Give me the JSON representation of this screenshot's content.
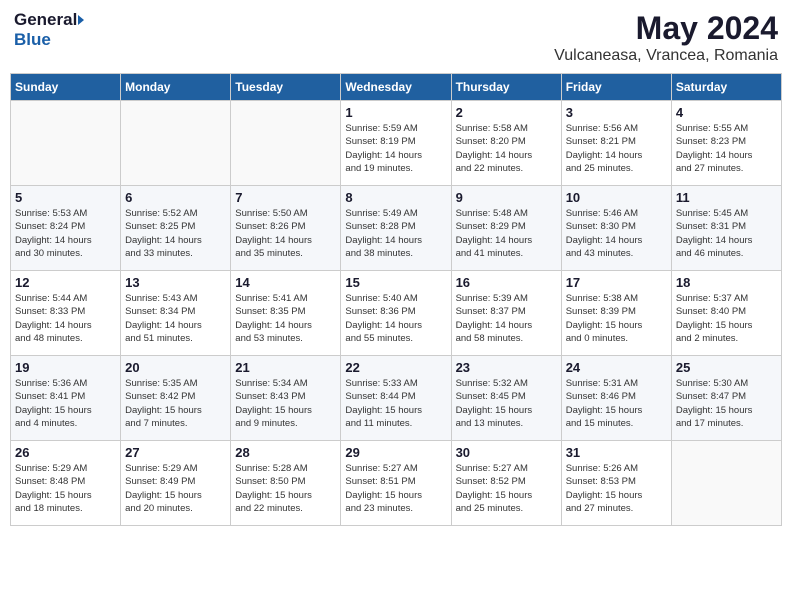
{
  "logo": {
    "general": "General",
    "blue": "Blue"
  },
  "title": "May 2024",
  "subtitle": "Vulcaneasa, Vrancea, Romania",
  "days_of_week": [
    "Sunday",
    "Monday",
    "Tuesday",
    "Wednesday",
    "Thursday",
    "Friday",
    "Saturday"
  ],
  "weeks": [
    [
      {
        "day": "",
        "info": ""
      },
      {
        "day": "",
        "info": ""
      },
      {
        "day": "",
        "info": ""
      },
      {
        "day": "1",
        "info": "Sunrise: 5:59 AM\nSunset: 8:19 PM\nDaylight: 14 hours\nand 19 minutes."
      },
      {
        "day": "2",
        "info": "Sunrise: 5:58 AM\nSunset: 8:20 PM\nDaylight: 14 hours\nand 22 minutes."
      },
      {
        "day": "3",
        "info": "Sunrise: 5:56 AM\nSunset: 8:21 PM\nDaylight: 14 hours\nand 25 minutes."
      },
      {
        "day": "4",
        "info": "Sunrise: 5:55 AM\nSunset: 8:23 PM\nDaylight: 14 hours\nand 27 minutes."
      }
    ],
    [
      {
        "day": "5",
        "info": "Sunrise: 5:53 AM\nSunset: 8:24 PM\nDaylight: 14 hours\nand 30 minutes."
      },
      {
        "day": "6",
        "info": "Sunrise: 5:52 AM\nSunset: 8:25 PM\nDaylight: 14 hours\nand 33 minutes."
      },
      {
        "day": "7",
        "info": "Sunrise: 5:50 AM\nSunset: 8:26 PM\nDaylight: 14 hours\nand 35 minutes."
      },
      {
        "day": "8",
        "info": "Sunrise: 5:49 AM\nSunset: 8:28 PM\nDaylight: 14 hours\nand 38 minutes."
      },
      {
        "day": "9",
        "info": "Sunrise: 5:48 AM\nSunset: 8:29 PM\nDaylight: 14 hours\nand 41 minutes."
      },
      {
        "day": "10",
        "info": "Sunrise: 5:46 AM\nSunset: 8:30 PM\nDaylight: 14 hours\nand 43 minutes."
      },
      {
        "day": "11",
        "info": "Sunrise: 5:45 AM\nSunset: 8:31 PM\nDaylight: 14 hours\nand 46 minutes."
      }
    ],
    [
      {
        "day": "12",
        "info": "Sunrise: 5:44 AM\nSunset: 8:33 PM\nDaylight: 14 hours\nand 48 minutes."
      },
      {
        "day": "13",
        "info": "Sunrise: 5:43 AM\nSunset: 8:34 PM\nDaylight: 14 hours\nand 51 minutes."
      },
      {
        "day": "14",
        "info": "Sunrise: 5:41 AM\nSunset: 8:35 PM\nDaylight: 14 hours\nand 53 minutes."
      },
      {
        "day": "15",
        "info": "Sunrise: 5:40 AM\nSunset: 8:36 PM\nDaylight: 14 hours\nand 55 minutes."
      },
      {
        "day": "16",
        "info": "Sunrise: 5:39 AM\nSunset: 8:37 PM\nDaylight: 14 hours\nand 58 minutes."
      },
      {
        "day": "17",
        "info": "Sunrise: 5:38 AM\nSunset: 8:39 PM\nDaylight: 15 hours\nand 0 minutes."
      },
      {
        "day": "18",
        "info": "Sunrise: 5:37 AM\nSunset: 8:40 PM\nDaylight: 15 hours\nand 2 minutes."
      }
    ],
    [
      {
        "day": "19",
        "info": "Sunrise: 5:36 AM\nSunset: 8:41 PM\nDaylight: 15 hours\nand 4 minutes."
      },
      {
        "day": "20",
        "info": "Sunrise: 5:35 AM\nSunset: 8:42 PM\nDaylight: 15 hours\nand 7 minutes."
      },
      {
        "day": "21",
        "info": "Sunrise: 5:34 AM\nSunset: 8:43 PM\nDaylight: 15 hours\nand 9 minutes."
      },
      {
        "day": "22",
        "info": "Sunrise: 5:33 AM\nSunset: 8:44 PM\nDaylight: 15 hours\nand 11 minutes."
      },
      {
        "day": "23",
        "info": "Sunrise: 5:32 AM\nSunset: 8:45 PM\nDaylight: 15 hours\nand 13 minutes."
      },
      {
        "day": "24",
        "info": "Sunrise: 5:31 AM\nSunset: 8:46 PM\nDaylight: 15 hours\nand 15 minutes."
      },
      {
        "day": "25",
        "info": "Sunrise: 5:30 AM\nSunset: 8:47 PM\nDaylight: 15 hours\nand 17 minutes."
      }
    ],
    [
      {
        "day": "26",
        "info": "Sunrise: 5:29 AM\nSunset: 8:48 PM\nDaylight: 15 hours\nand 18 minutes."
      },
      {
        "day": "27",
        "info": "Sunrise: 5:29 AM\nSunset: 8:49 PM\nDaylight: 15 hours\nand 20 minutes."
      },
      {
        "day": "28",
        "info": "Sunrise: 5:28 AM\nSunset: 8:50 PM\nDaylight: 15 hours\nand 22 minutes."
      },
      {
        "day": "29",
        "info": "Sunrise: 5:27 AM\nSunset: 8:51 PM\nDaylight: 15 hours\nand 23 minutes."
      },
      {
        "day": "30",
        "info": "Sunrise: 5:27 AM\nSunset: 8:52 PM\nDaylight: 15 hours\nand 25 minutes."
      },
      {
        "day": "31",
        "info": "Sunrise: 5:26 AM\nSunset: 8:53 PM\nDaylight: 15 hours\nand 27 minutes."
      },
      {
        "day": "",
        "info": ""
      }
    ]
  ]
}
